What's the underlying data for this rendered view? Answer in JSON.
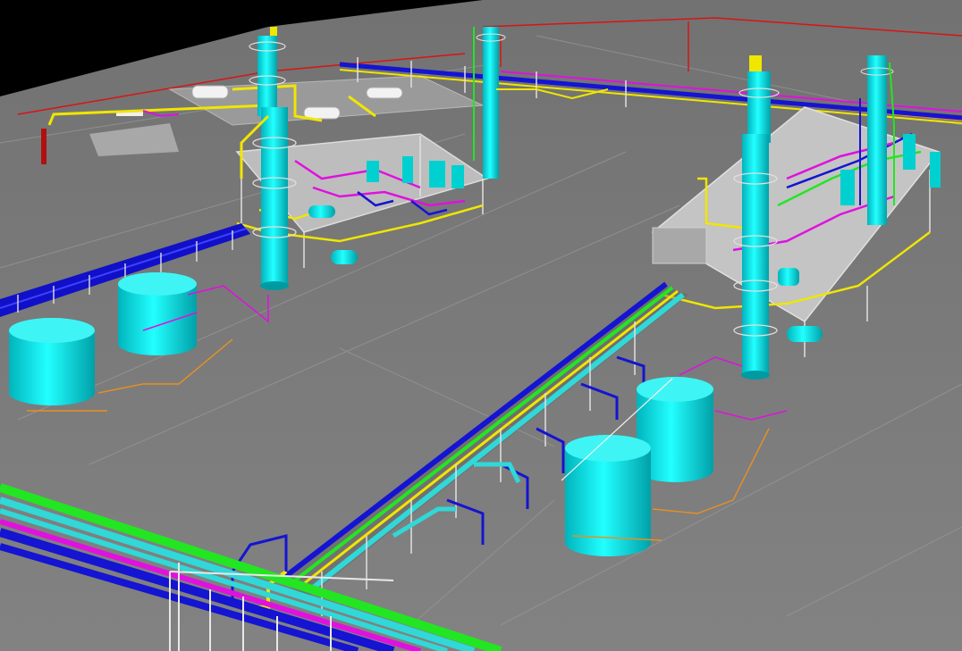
{
  "scene": {
    "kind": "3d-plant-model-render",
    "objects": [
      "distillation-column-left",
      "distillation-column-left-tall",
      "distillation-column-right",
      "distillation-column-right-back",
      "storage-tank",
      "pipe-rack",
      "process-platform",
      "horizontal-vessel",
      "background-skid"
    ],
    "colors": {
      "sky": "#000000",
      "ground": "#7d7d7d",
      "ground_dark": "#6f6f6f",
      "equipment": "#00e5e5",
      "equipment_shade": "#00a8b0",
      "pipe_blue": "#1414d2",
      "pipe_green": "#22e622",
      "pipe_yellow": "#f0e600",
      "pipe_magenta": "#e010e0",
      "pipe_cyan": "#30d8d8",
      "pipe_red": "#d81414",
      "pipe_orange": "#e89020",
      "steel_white": "#e0e0e0",
      "platform": "#c8c8c8"
    }
  }
}
